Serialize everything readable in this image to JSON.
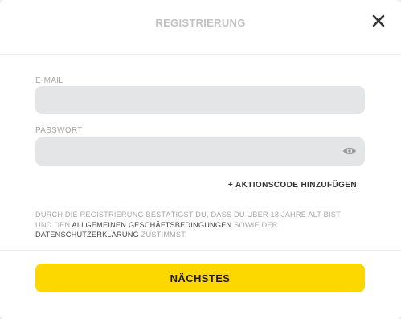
{
  "modal": {
    "title": "REGISTRIERUNG"
  },
  "form": {
    "email_label": "E-MAIL",
    "email_value": "",
    "password_label": "PASSWORT",
    "password_value": "",
    "promo_link": "+ AKTIONSCODE HINZUFÜGEN"
  },
  "terms": {
    "text_1": "DURCH DIE REGISTRIERUNG BESTÄTIGST DU, DASS DU ÜBER 18 JAHRE ALT BIST UND DEN ",
    "link_1": "ALLGEMEINEN GESCHÄFTSBEDINGUNGEN",
    "text_2": " SOWIE DER ",
    "link_2": "DATENSCHUTZERKLÄRUNG",
    "text_3": " ZUSTIMMST."
  },
  "actions": {
    "next_label": "NÄCHSTES"
  },
  "icons": {
    "close": "close-icon",
    "password_toggle": "eye-icon"
  },
  "colors": {
    "accent": "#fdd800",
    "field_bg": "#e4e5e6",
    "muted_text": "#a6a6a6"
  }
}
